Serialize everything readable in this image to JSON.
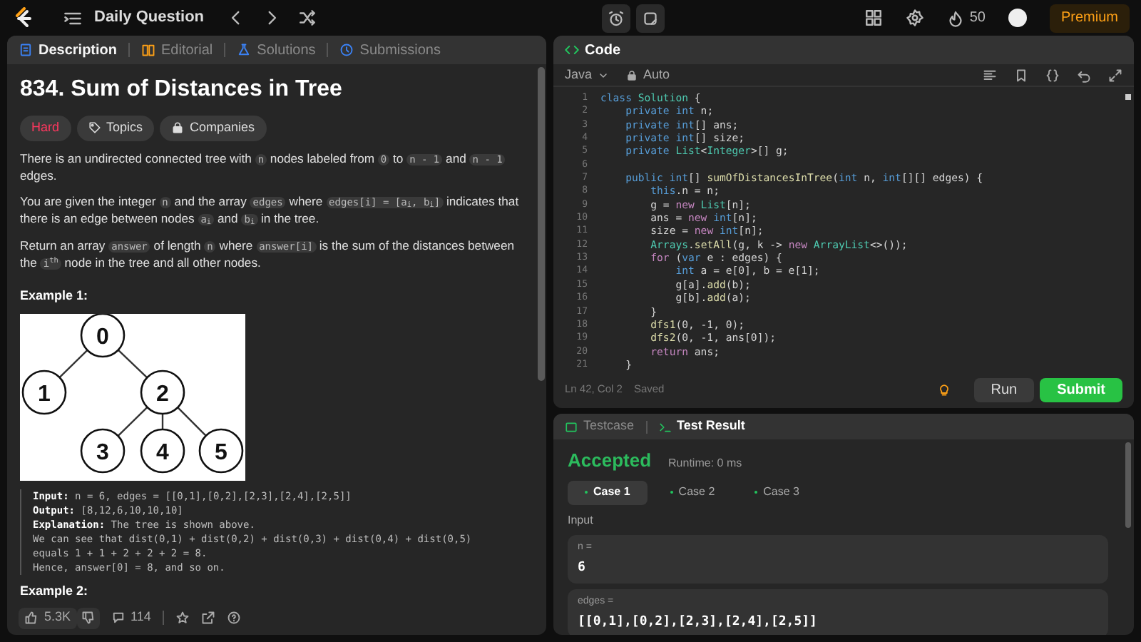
{
  "topbar": {
    "title": "Daily Question",
    "streak": "50",
    "premium": "Premium"
  },
  "left_tabs": [
    {
      "label": "Description",
      "selected": true
    },
    {
      "label": "Editorial",
      "selected": false
    },
    {
      "label": "Solutions",
      "selected": false
    },
    {
      "label": "Submissions",
      "selected": false
    }
  ],
  "problem": {
    "title": "834. Sum of Distances in Tree",
    "difficulty": "Hard",
    "tags": [
      "Topics",
      "Companies"
    ],
    "paragraphs": [
      [
        {
          "kind": "text",
          "t": "There is an undirected connected tree with "
        },
        {
          "kind": "code",
          "t": "n"
        },
        {
          "kind": "text",
          "t": " nodes labeled from "
        },
        {
          "kind": "code",
          "t": "0"
        },
        {
          "kind": "text",
          "t": " to "
        },
        {
          "kind": "code",
          "t": "n - 1"
        },
        {
          "kind": "text",
          "t": " and "
        },
        {
          "kind": "code",
          "t": "n - 1"
        },
        {
          "kind": "text",
          "t": " edges."
        }
      ],
      [
        {
          "kind": "text",
          "t": "You are given the integer "
        },
        {
          "kind": "code",
          "t": "n"
        },
        {
          "kind": "text",
          "t": " and the array "
        },
        {
          "kind": "code",
          "t": "edges"
        },
        {
          "kind": "text",
          "t": " where "
        },
        {
          "kind": "code",
          "t": "edges[i] = [a$_{i}$, b$_{i}$]"
        },
        {
          "kind": "text",
          "t": " indicates that there is an edge between nodes "
        },
        {
          "kind": "code",
          "t": "a$_{i}$"
        },
        {
          "kind": "text",
          "t": " and "
        },
        {
          "kind": "code",
          "t": "b$_{i}$"
        },
        {
          "kind": "text",
          "t": " in the tree."
        }
      ],
      [
        {
          "kind": "text",
          "t": "Return an array "
        },
        {
          "kind": "code",
          "t": "answer"
        },
        {
          "kind": "text",
          "t": " of length "
        },
        {
          "kind": "code",
          "t": "n"
        },
        {
          "kind": "text",
          "t": " where "
        },
        {
          "kind": "code",
          "t": "answer[i]"
        },
        {
          "kind": "text",
          "t": " is the sum of the distances between the "
        },
        {
          "kind": "code",
          "t": "i$^{th}$"
        },
        {
          "kind": "text",
          "t": " node in the tree and all other nodes."
        }
      ]
    ],
    "example_heading": "Example 1:",
    "tree_nodes": [
      "0",
      "1",
      "2",
      "3",
      "4",
      "5"
    ],
    "example_lines": [
      "**Input:** n = 6, edges = [[0,1],[0,2],[2,3],[2,4],[2,5]]",
      "**Output:** [8,12,6,10,10,10]",
      "**Explanation:** The tree is shown above.",
      "We can see that dist(0,1) + dist(0,2) + dist(0,3) + dist(0,4) + dist(0,5)",
      "equals 1 + 1 + 2 + 2 + 2 = 8.",
      "Hence, answer[0] = 8, and so on."
    ],
    "example2_heading": "Example 2:",
    "likes": "5.3K",
    "comments": "114"
  },
  "code_panel": {
    "title": "Code",
    "language": "Java",
    "mode": "Auto",
    "lines": [
      {
        "kind": "code",
        "tokens": [
          {
            "t": "class ",
            "kind": "kw"
          },
          {
            "t": "Solution ",
            "kind": "type"
          },
          {
            "t": "{",
            "kind": "txt"
          }
        ]
      },
      {
        "kind": "code",
        "tokens": [
          {
            "t": "    private int ",
            "kind": "kw"
          },
          {
            "t": "n;",
            "kind": "txt"
          }
        ]
      },
      {
        "kind": "code",
        "tokens": [
          {
            "t": "    private int",
            "kind": "kw"
          },
          {
            "t": "[] ans;",
            "kind": "txt"
          }
        ]
      },
      {
        "kind": "code",
        "tokens": [
          {
            "t": "    private int",
            "kind": "kw"
          },
          {
            "t": "[] size;",
            "kind": "txt"
          }
        ]
      },
      {
        "kind": "code",
        "tokens": [
          {
            "t": "    private ",
            "kind": "kw"
          },
          {
            "t": "List",
            "kind": "type"
          },
          {
            "t": "<",
            "kind": "txt"
          },
          {
            "t": "Integer",
            "kind": "type"
          },
          {
            "t": ">[] g;",
            "kind": "txt"
          }
        ]
      },
      {
        "kind": "blank"
      },
      {
        "kind": "code",
        "tokens": [
          {
            "t": "    public int",
            "kind": "kw"
          },
          {
            "t": "[] ",
            "kind": "txt"
          },
          {
            "t": "sumOfDistancesInTree",
            "kind": "fn"
          },
          {
            "t": "(",
            "kind": "txt"
          },
          {
            "t": "int ",
            "kind": "kw"
          },
          {
            "t": "n, ",
            "kind": "txt"
          },
          {
            "t": "int",
            "kind": "kw"
          },
          {
            "t": "[][] edges) {",
            "kind": "txt"
          }
        ]
      },
      {
        "kind": "code",
        "tokens": [
          {
            "t": "        this",
            "kind": "kw"
          },
          {
            "t": ".n = n;",
            "kind": "txt"
          }
        ]
      },
      {
        "kind": "code",
        "tokens": [
          {
            "t": "        g = ",
            "kind": "txt"
          },
          {
            "t": "new ",
            "kind": "ctl"
          },
          {
            "t": "List",
            "kind": "type"
          },
          {
            "t": "[n];",
            "kind": "txt"
          }
        ]
      },
      {
        "kind": "code",
        "tokens": [
          {
            "t": "        ans = ",
            "kind": "txt"
          },
          {
            "t": "new ",
            "kind": "ctl"
          },
          {
            "t": "int",
            "kind": "kw"
          },
          {
            "t": "[n];",
            "kind": "txt"
          }
        ]
      },
      {
        "kind": "code",
        "tokens": [
          {
            "t": "        size = ",
            "kind": "txt"
          },
          {
            "t": "new ",
            "kind": "ctl"
          },
          {
            "t": "int",
            "kind": "kw"
          },
          {
            "t": "[n];",
            "kind": "txt"
          }
        ]
      },
      {
        "kind": "code",
        "tokens": [
          {
            "t": "        Arrays",
            "kind": "type"
          },
          {
            "t": ".",
            "kind": "txt"
          },
          {
            "t": "setAll",
            "kind": "fn"
          },
          {
            "t": "(g, k -> ",
            "kind": "txt"
          },
          {
            "t": "new ",
            "kind": "ctl"
          },
          {
            "t": "ArrayList",
            "kind": "type"
          },
          {
            "t": "<>());",
            "kind": "txt"
          }
        ]
      },
      {
        "kind": "code",
        "tokens": [
          {
            "t": "        for ",
            "kind": "ctl"
          },
          {
            "t": "(",
            "kind": "txt"
          },
          {
            "t": "var ",
            "kind": "kw"
          },
          {
            "t": "e : edges) {",
            "kind": "txt"
          }
        ]
      },
      {
        "kind": "code",
        "tokens": [
          {
            "t": "            int ",
            "kind": "kw"
          },
          {
            "t": "a = e[0], b = e[1];",
            "kind": "txt"
          }
        ]
      },
      {
        "kind": "code",
        "tokens": [
          {
            "t": "            g[a].",
            "kind": "txt"
          },
          {
            "t": "add",
            "kind": "fn"
          },
          {
            "t": "(b);",
            "kind": "txt"
          }
        ]
      },
      {
        "kind": "code",
        "tokens": [
          {
            "t": "            g[b].",
            "kind": "txt"
          },
          {
            "t": "add",
            "kind": "fn"
          },
          {
            "t": "(a);",
            "kind": "txt"
          }
        ]
      },
      {
        "kind": "code",
        "tokens": [
          {
            "t": "        }",
            "kind": "txt"
          }
        ]
      },
      {
        "kind": "code",
        "tokens": [
          {
            "t": "        dfs1",
            "kind": "fn"
          },
          {
            "t": "(0, -1, 0);",
            "kind": "txt"
          }
        ]
      },
      {
        "kind": "code",
        "tokens": [
          {
            "t": "        dfs2",
            "kind": "fn"
          },
          {
            "t": "(0, -1, ans[0]);",
            "kind": "txt"
          }
        ]
      },
      {
        "kind": "code",
        "tokens": [
          {
            "t": "        return ",
            "kind": "ctl"
          },
          {
            "t": "ans;",
            "kind": "txt"
          }
        ]
      },
      {
        "kind": "code",
        "tokens": [
          {
            "t": "    }",
            "kind": "txt"
          }
        ]
      }
    ],
    "line_numbers": [
      "1",
      "2",
      "3",
      "4",
      "5",
      "6",
      "7",
      "8",
      "9",
      "10",
      "11",
      "12",
      "13",
      "14",
      "15",
      "16",
      "17",
      "18",
      "19",
      "20",
      "21"
    ],
    "cursor": "Ln 42, Col 2",
    "save_state": "Saved",
    "run": "Run",
    "submit": "Submit"
  },
  "result_tabs": [
    {
      "label": "Testcase",
      "selected": false
    },
    {
      "label": "Test Result",
      "selected": true
    }
  ],
  "result": {
    "verdict": "Accepted",
    "runtime": "Runtime: 0 ms",
    "cases": [
      {
        "label": "Case 1",
        "selected": true
      },
      {
        "label": "Case 2",
        "selected": false
      },
      {
        "label": "Case 3",
        "selected": false
      }
    ],
    "section": "Input",
    "inputs": [
      {
        "name": "n =",
        "value": "6"
      },
      {
        "name": "edges =",
        "value": "[[0,1],[0,2],[2,3],[2,4],[2,5]]"
      }
    ]
  }
}
